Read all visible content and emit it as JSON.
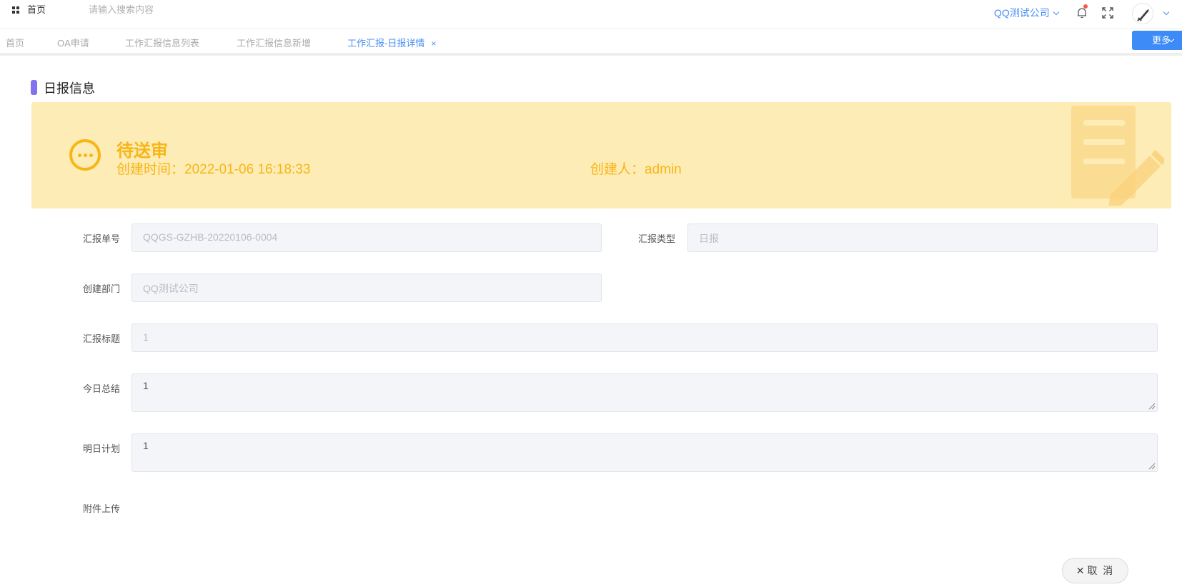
{
  "header": {
    "home_label": "首页",
    "search_placeholder": "请输入搜索内容",
    "company": "QQ测试公司"
  },
  "tabs": [
    {
      "label": "首页",
      "active": false
    },
    {
      "label": "OA申请",
      "active": false
    },
    {
      "label": "工作汇报信息列表",
      "active": false
    },
    {
      "label": "工作汇报信息新增",
      "active": false
    },
    {
      "label": "工作汇报-日报详情",
      "active": true,
      "closable": true
    }
  ],
  "more_label": "更多",
  "section_title": "日报信息",
  "banner": {
    "status": "待送审",
    "created_time": "创建时间：2022-01-06 16:18:33",
    "creator": "创建人：admin"
  },
  "form": {
    "report_no_label": "汇报单号",
    "report_no_value": "QQGS-GZHB-20220106-0004",
    "report_type_label": "汇报类型",
    "report_type_value": "日报",
    "dept_label": "创建部门",
    "dept_value": "QQ测试公司",
    "title_label": "汇报标题",
    "title_value": "1",
    "summary_label": "今日总结",
    "summary_value": "1",
    "plan_label": "明日计划",
    "plan_value": "1",
    "attachment_label": "附件上传"
  },
  "cancel_label": "取 消",
  "colors": {
    "primary": "#3c8bf6",
    "status": "#f8b516",
    "banner_bg": "#fdecb6",
    "section_mark": "#8174ee"
  }
}
